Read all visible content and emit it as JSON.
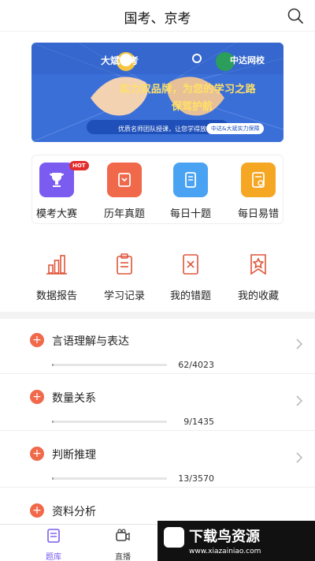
{
  "header": {
    "title": "国考、京考",
    "search_icon": "search-icon"
  },
  "banner": {
    "brand_left": "大斌公考",
    "brand_right": "中达网校",
    "slogan_line1": "实力双品牌，为您的学习之路",
    "slogan_line2": "保驾护航",
    "footer_left": "优质名师团队授课，让您学得放心",
    "footer_right": "中达&大斌实力保障",
    "colors": {
      "background": "#3a6fd8",
      "accent": "#ffe066"
    }
  },
  "features": [
    {
      "label": "模考大赛",
      "icon": "trophy-icon",
      "color": "#7b5cf0",
      "badge": "HOT"
    },
    {
      "label": "历年真题",
      "icon": "paper-bag-icon",
      "color": "#f0694b"
    },
    {
      "label": "每日十题",
      "icon": "tablet-icon",
      "color": "#4aa3f2"
    },
    {
      "label": "每日易错",
      "icon": "note-icon",
      "color": "#f5a623"
    }
  ],
  "tools": [
    {
      "label": "数据报告",
      "icon": "bar-chart-icon"
    },
    {
      "label": "学习记录",
      "icon": "clipboard-icon"
    },
    {
      "label": "我的错题",
      "icon": "error-doc-icon"
    },
    {
      "label": "我的收藏",
      "icon": "star-bookmark-icon"
    }
  ],
  "subjects": [
    {
      "name": "言语理解与表达",
      "count": "62/4023",
      "progress": 0.0154
    },
    {
      "name": "数量关系",
      "count": "9/1435",
      "progress": 0.0063
    },
    {
      "name": "判断推理",
      "count": "13/3570",
      "progress": 0.0036
    },
    {
      "name": "资料分析",
      "count": "",
      "progress": 0
    }
  ],
  "tabbar": [
    {
      "label": "题库",
      "icon": "question-bank-icon",
      "active": true
    },
    {
      "label": "直播",
      "icon": "live-camera-icon",
      "active": false
    }
  ],
  "watermark": {
    "title": "下载鸟资源",
    "url": "www.xiazainiao.com"
  },
  "theme": {
    "accent": "#f0694b",
    "active_tab": "#7b5cf0"
  }
}
